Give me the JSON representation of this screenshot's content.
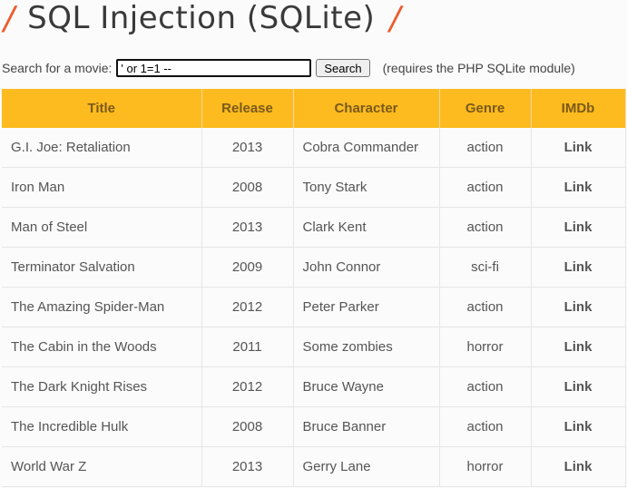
{
  "header": {
    "title": "SQL Injection (SQLite)",
    "slash_left": "/",
    "slash_right": "/"
  },
  "search": {
    "label": "Search for a movie:",
    "value": "' or 1=1 --",
    "button": "Search",
    "note": "(requires the PHP SQLite module)"
  },
  "table": {
    "headers": [
      "Title",
      "Release",
      "Character",
      "Genre",
      "IMDb"
    ],
    "rows": [
      {
        "title": "G.I. Joe: Retaliation",
        "release": "2013",
        "character": "Cobra Commander",
        "genre": "action",
        "imdb": "Link"
      },
      {
        "title": "Iron Man",
        "release": "2008",
        "character": "Tony Stark",
        "genre": "action",
        "imdb": "Link"
      },
      {
        "title": "Man of Steel",
        "release": "2013",
        "character": "Clark Kent",
        "genre": "action",
        "imdb": "Link"
      },
      {
        "title": "Terminator Salvation",
        "release": "2009",
        "character": "John Connor",
        "genre": "sci-fi",
        "imdb": "Link"
      },
      {
        "title": "The Amazing Spider-Man",
        "release": "2012",
        "character": "Peter Parker",
        "genre": "action",
        "imdb": "Link"
      },
      {
        "title": "The Cabin in the Woods",
        "release": "2011",
        "character": "Some zombies",
        "genre": "horror",
        "imdb": "Link"
      },
      {
        "title": "The Dark Knight Rises",
        "release": "2012",
        "character": "Bruce Wayne",
        "genre": "action",
        "imdb": "Link"
      },
      {
        "title": "The Incredible Hulk",
        "release": "2008",
        "character": "Bruce Banner",
        "genre": "action",
        "imdb": "Link"
      },
      {
        "title": "World War Z",
        "release": "2013",
        "character": "Gerry Lane",
        "genre": "horror",
        "imdb": "Link"
      }
    ]
  },
  "colors": {
    "accent": "#fdbb20",
    "slash": "#ee5b2c"
  }
}
